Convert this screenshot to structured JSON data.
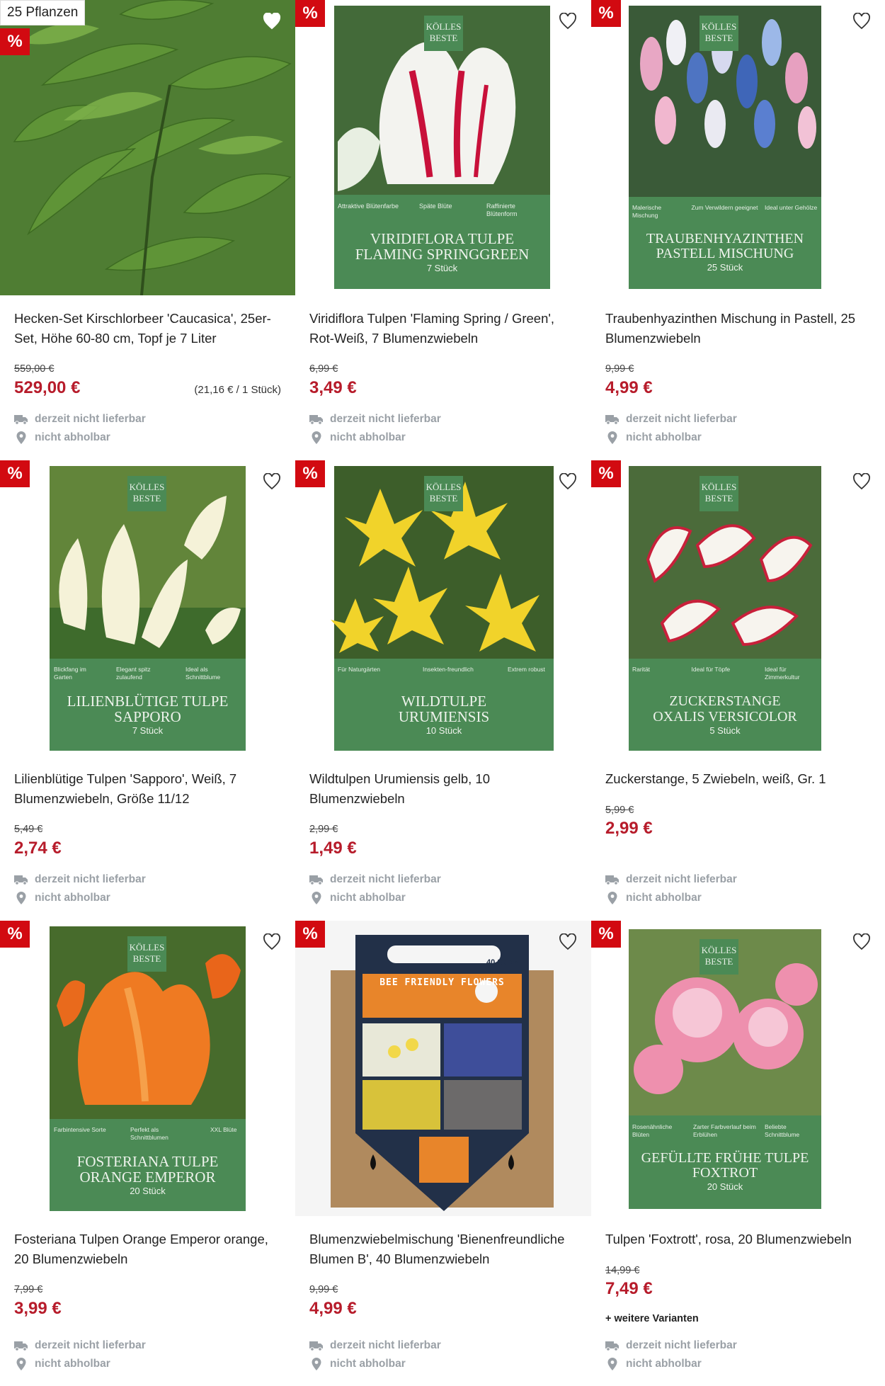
{
  "products": [
    {
      "badge": "25 Pflanzen",
      "sale": "%",
      "title": "Hecken-Set Kirschlorbeer 'Caucasica', 25er-Set, Höhe 60-80 cm, Topf je 7 Liter",
      "old_price": "559,00 €",
      "price": "529,00 €",
      "unit_price": "(21,16 € / 1 Stück)",
      "delivery": "derzeit nicht lieferbar",
      "pickup": "nicht abholbar",
      "image": "hedge-leaves-photo"
    },
    {
      "sale": "%",
      "title": "Viridiflora Tulpen 'Flaming Spring / Green', Rot-Weiß, 7 Blumenzwiebeln",
      "old_price": "6,99 €",
      "price": "3,49 €",
      "delivery": "derzeit nicht lieferbar",
      "pickup": "nicht abholbar",
      "pack": {
        "brand": [
          "KÖLLES",
          "BESTE"
        ],
        "features": [
          "Attraktive Blütenfarbe",
          "Späte Blüte",
          "Raffinierte Blütenform"
        ],
        "name": [
          "VIRIDIFLORA TULPE",
          "FLAMING SPRINGGREEN"
        ],
        "count": "7 Stück"
      }
    },
    {
      "sale": "%",
      "title": "Traubenhyazinthen Mischung in Pastell, 25 Blumenzwiebeln",
      "old_price": "9,99 €",
      "price": "4,99 €",
      "delivery": "derzeit nicht lieferbar",
      "pickup": "nicht abholbar",
      "pack": {
        "brand": [
          "KÖLLES",
          "BESTE"
        ],
        "features": [
          "Malerische Mischung",
          "Zum Verwildern geeignet",
          "Ideal unter Gehölze"
        ],
        "name": [
          "TRAUBENHYAZINTHEN",
          "PASTELL MISCHUNG"
        ],
        "count": "25 Stück"
      }
    },
    {
      "sale": "%",
      "title": "Lilienblütige Tulpen 'Sapporo', Weiß, 7 Blumenzwiebeln, Größe 11/12",
      "old_price": "5,49 €",
      "price": "2,74 €",
      "delivery": "derzeit nicht lieferbar",
      "pickup": "nicht abholbar",
      "pack": {
        "brand": [
          "KÖLLES",
          "BESTE"
        ],
        "features": [
          "Blickfang im Garten",
          "Elegant spitz zulaufend",
          "Ideal als Schnittblume"
        ],
        "name": [
          "LILIENBLÜTIGE TULPE",
          "SAPPORO"
        ],
        "count": "7 Stück"
      }
    },
    {
      "sale": "%",
      "title": "Wildtulpen Urumiensis gelb, 10 Blumenzwiebeln",
      "old_price": "2,99 €",
      "price": "1,49 €",
      "delivery": "derzeit nicht lieferbar",
      "pickup": "nicht abholbar",
      "pack": {
        "brand": [
          "KÖLLES",
          "BESTE"
        ],
        "features": [
          "Für Naturgärten",
          "Insekten-freundlich",
          "Extrem robust"
        ],
        "name": [
          "WILDTULPE",
          "URUMIENSIS"
        ],
        "count": "10 Stück"
      }
    },
    {
      "sale": "%",
      "title": "Zuckerstange, 5 Zwiebeln, weiß, Gr. 1",
      "old_price": "5,99 €",
      "price": "2,99 €",
      "delivery": "derzeit nicht lieferbar",
      "pickup": "nicht abholbar",
      "pack": {
        "brand": [
          "KÖLLES",
          "BESTE"
        ],
        "features": [
          "Rarität",
          "Ideal für Töpfe",
          "Ideal für Zimmerkultur"
        ],
        "name": [
          "ZUCKERSTANGE",
          "OXALIS VERSICOLOR"
        ],
        "count": "5 Stück"
      }
    },
    {
      "sale": "%",
      "title": "Fosteriana Tulpen Orange Emperor orange, 20 Blumenzwiebeln",
      "old_price": "7,99 €",
      "price": "3,99 €",
      "delivery": "derzeit nicht lieferbar",
      "pickup": "nicht abholbar",
      "pack": {
        "brand": [
          "KÖLLES",
          "BESTE"
        ],
        "features": [
          "Farbintensive Sorte",
          "Perfekt als Schnittblumen",
          "XXL Blüte"
        ],
        "name": [
          "FOSTERIANA TULPE",
          "ORANGE EMPEROR"
        ],
        "count": "20 Stück"
      }
    },
    {
      "sale": "%",
      "title": "Blumenzwiebelmischung 'Bienenfreundliche Blumen B', 40 Blumenzwiebeln",
      "old_price": "9,99 €",
      "price": "4,99 €",
      "delivery": "derzeit nicht lieferbar",
      "pickup": "nicht abholbar",
      "bag": {
        "count": "40 Stück",
        "name": "BEE FRIENDLY FLOWERS"
      }
    },
    {
      "sale": "%",
      "title": "Tulpen 'Foxtrott', rosa, 20 Blumenzwiebeln",
      "old_price": "14,99 €",
      "price": "7,49 €",
      "variants": "+ weitere Varianten",
      "delivery": "derzeit nicht lieferbar",
      "pickup": "nicht abholbar",
      "pack": {
        "brand": [
          "KÖLLES",
          "BESTE"
        ],
        "features": [
          "Rosenähnliche Blüten",
          "Zarter Farbverlauf beim Erblühen",
          "Beliebte Schnittblume"
        ],
        "name": [
          "GEFÜLLTE FRÜHE TULPE",
          "FOXTROT"
        ],
        "count": "20 Stück"
      }
    }
  ],
  "colors": {
    "sale_red": "#d20a11",
    "price_red": "#b71c2b",
    "pack_green": "#4b8a55",
    "status_gray": "#9aa0a6"
  }
}
